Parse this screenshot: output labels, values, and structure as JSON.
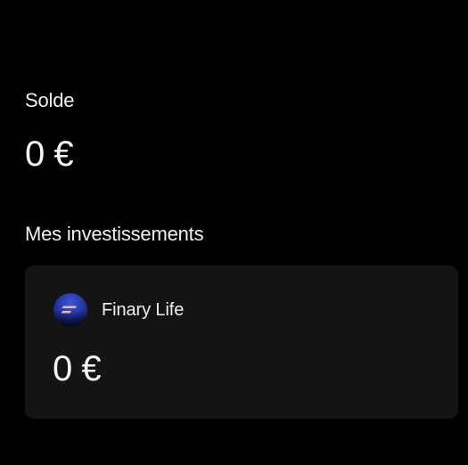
{
  "balance": {
    "label": "Solde",
    "value": "0 €"
  },
  "investments": {
    "title": "Mes investissements",
    "items": [
      {
        "name": "Finary Life",
        "value": "0 €",
        "icon": "finary-logo-icon"
      }
    ]
  },
  "colors": {
    "background": "#000000",
    "card": "#141414",
    "text": "#f3f3f3",
    "logo_blue": "#2d3fb0",
    "logo_accent": "#f2b98a"
  }
}
